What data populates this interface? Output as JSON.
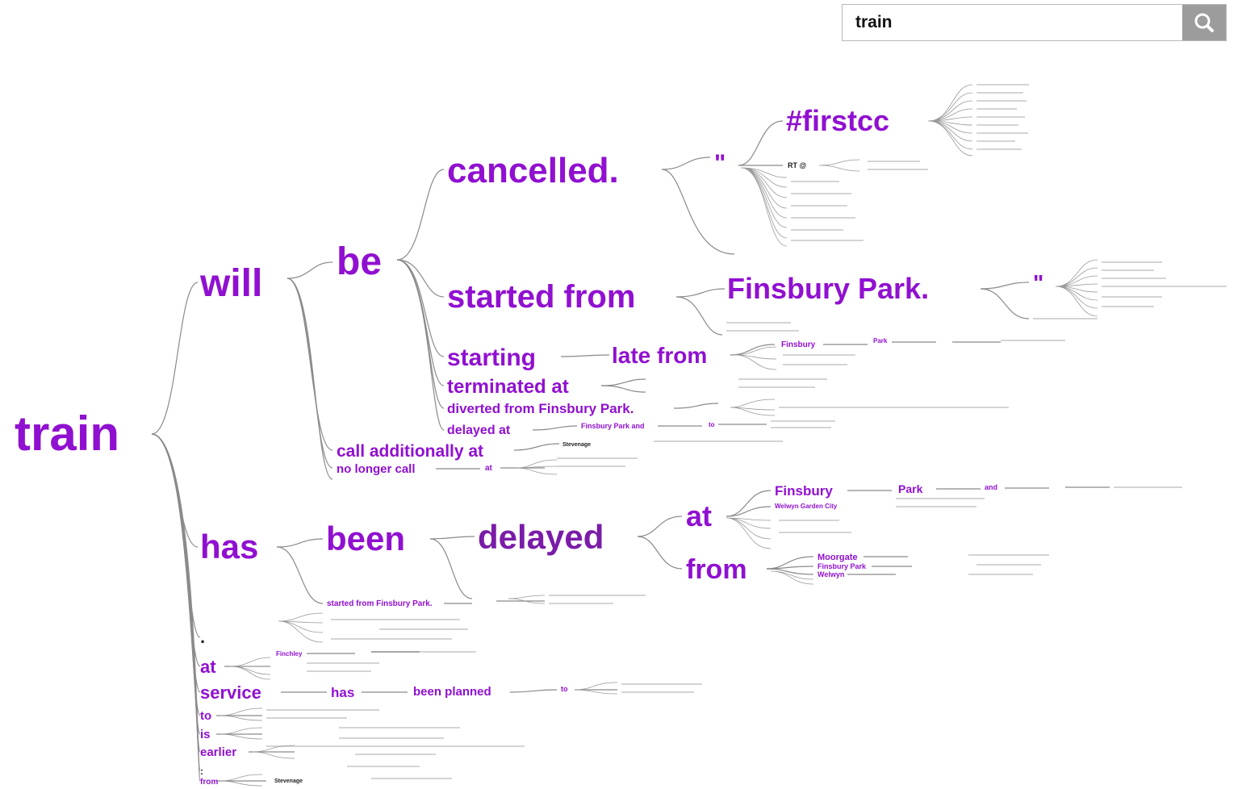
{
  "search": {
    "query": "train",
    "button_icon": "search-icon"
  },
  "tree": {
    "root": "train",
    "will": "will",
    "be": "be",
    "cancelled": "cancelled.",
    "quote1": "\"",
    "firstcc": "#firstcc",
    "rt_at": "RT @",
    "started_from": "started from",
    "finsbury_park": "Finsbury Park.",
    "quote2": "\"",
    "starting": "starting",
    "late_from": "late from",
    "finsbury": "Finsbury",
    "park_small": "Park",
    "terminated_at": "terminated at",
    "diverted_from": "diverted from Finsbury Park.",
    "delayed_at": "delayed at",
    "finsbury_park_and": "Finsbury Park and",
    "to_small": "to",
    "call_additionally_at": "call additionally at",
    "no_longer_call": "no longer call",
    "at_small": "at",
    "stevenage": "Stevenage",
    "has": "has",
    "been": "been",
    "delayed": "delayed",
    "at": "at",
    "from": "from",
    "finsbury2": "Finsbury",
    "park2": "Park",
    "and_small": "and",
    "welwyn_garden_city": "Welwyn Garden City",
    "moorgate": "Moorgate",
    "finsbury_park_small": "Finsbury Park",
    "welwyn": "Welwyn",
    "started_from_finsbury_park": "started from Finsbury Park.",
    "dot": ".",
    "at2": "at",
    "finchley": "Finchley",
    "service": "service",
    "has2": "has",
    "been_planned": "been planned",
    "to_small2": "to",
    "to": "to",
    "is": "is",
    "earlier": "earlier",
    "colon": ":",
    "from2": "from",
    "stevenage2": "Stevenage"
  }
}
